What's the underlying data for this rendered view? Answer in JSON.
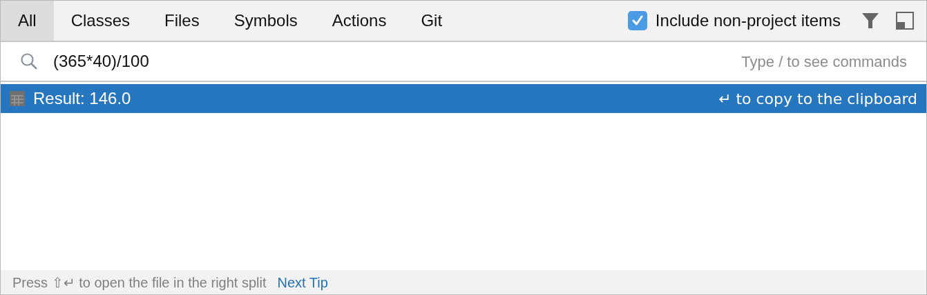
{
  "tabs": [
    {
      "label": "All",
      "selected": true
    },
    {
      "label": "Classes",
      "selected": false
    },
    {
      "label": "Files",
      "selected": false
    },
    {
      "label": "Symbols",
      "selected": false
    },
    {
      "label": "Actions",
      "selected": false
    },
    {
      "label": "Git",
      "selected": false
    }
  ],
  "include_checkbox": {
    "label": "Include non-project items",
    "checked": true
  },
  "search": {
    "value": "(365*40)/100",
    "hint": "Type / to see commands"
  },
  "results": [
    {
      "text": "Result: 146.0",
      "hint": "↵ to copy to the clipboard",
      "selected": true
    }
  ],
  "footer": {
    "text": "Press ⇧↵ to open the file in the right split",
    "link": "Next Tip"
  }
}
